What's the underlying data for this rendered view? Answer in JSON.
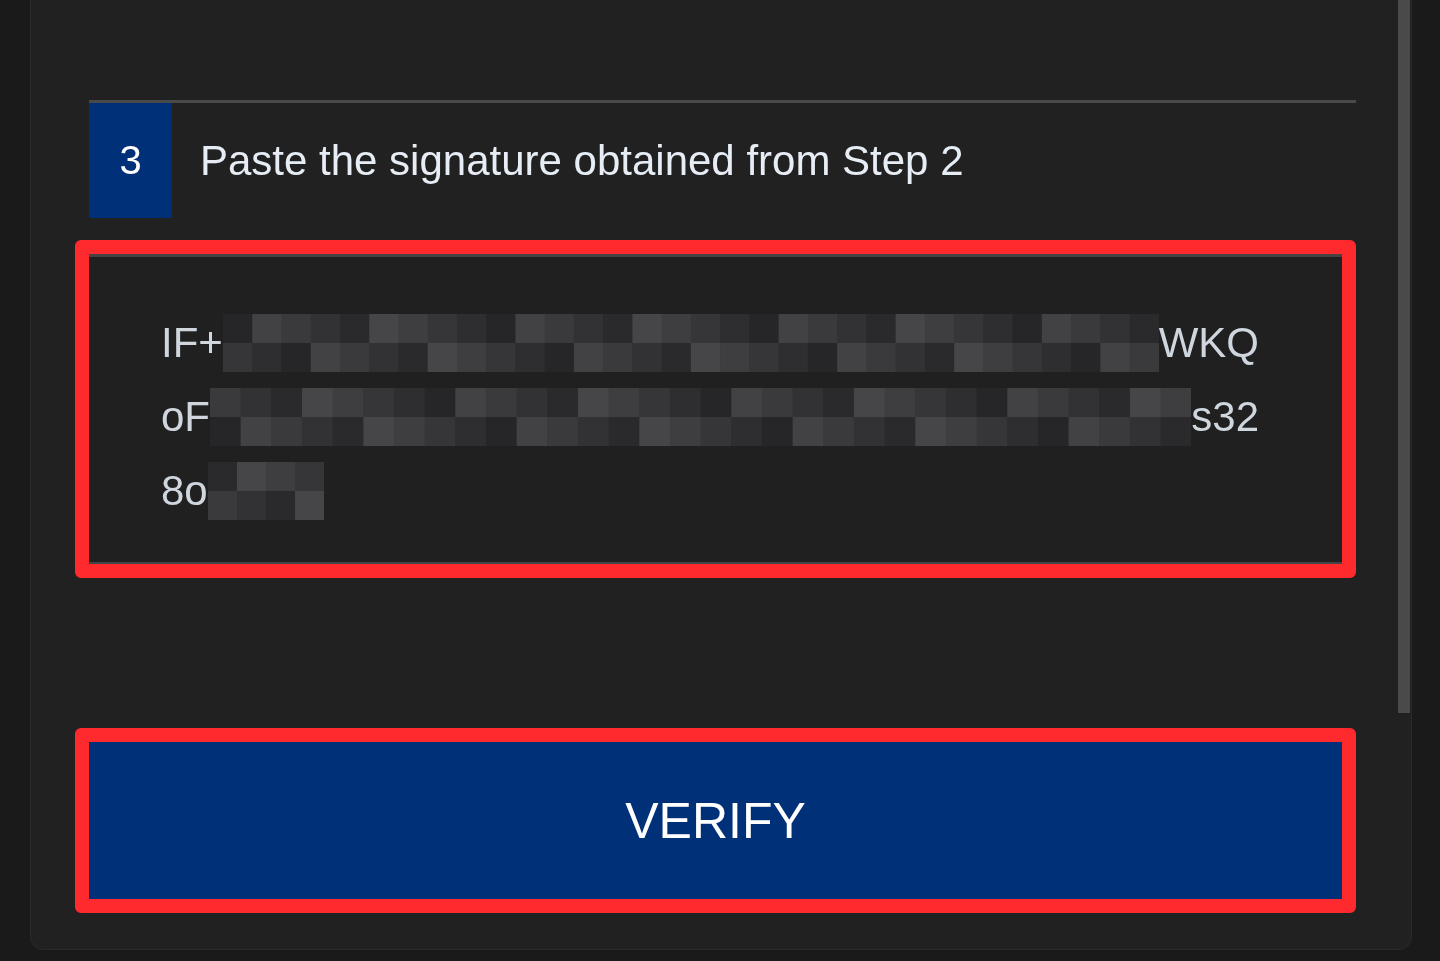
{
  "step": {
    "number": "3",
    "title": "Paste the signature obtained from Step 2"
  },
  "signature_lines": [
    {
      "start": "IF+",
      "end": "WKQ"
    },
    {
      "start": "oF",
      "end": "s32"
    },
    {
      "start": "8o"
    }
  ],
  "verify_button": {
    "label": "VERIFY"
  }
}
